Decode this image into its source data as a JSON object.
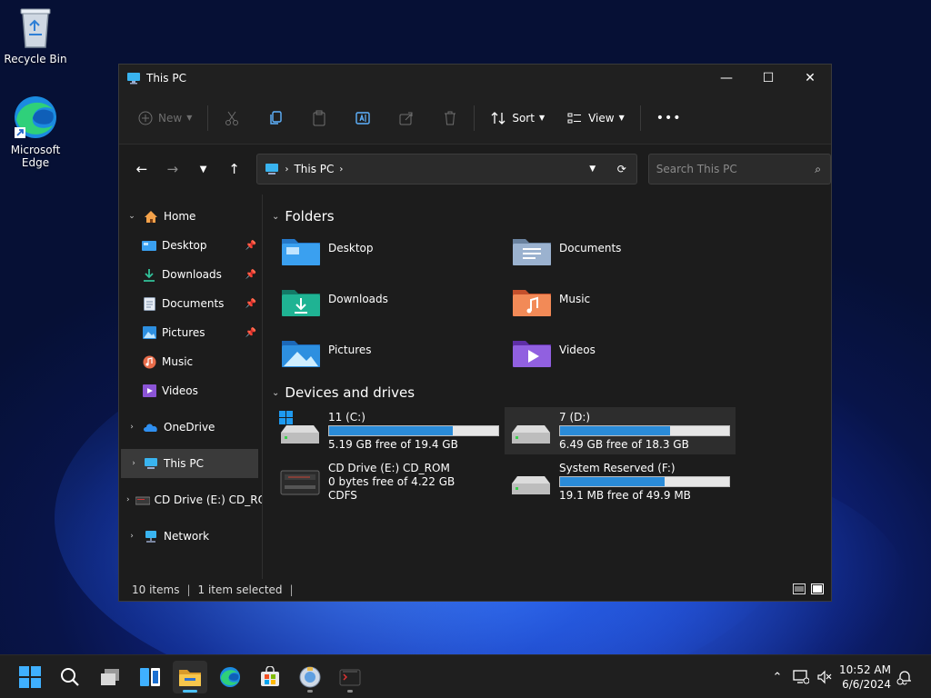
{
  "desktop": {
    "icons": [
      {
        "label": "Recycle Bin"
      },
      {
        "label": "Microsoft Edge"
      }
    ]
  },
  "window": {
    "title": "This PC",
    "controls": {
      "minimize": "—",
      "maximize": "☐",
      "close": "✕"
    }
  },
  "toolbar": {
    "new_label": "New",
    "sort_label": "Sort",
    "view_label": "View",
    "more_label": "•••"
  },
  "navigation": {
    "address": {
      "crumb": "This PC"
    },
    "search_placeholder": "Search This PC"
  },
  "sidebar": {
    "home": "Home",
    "pinned": [
      "Desktop",
      "Downloads",
      "Documents",
      "Pictures",
      "Music",
      "Videos"
    ],
    "onedrive": "OneDrive",
    "thispc": "This PC",
    "cddrive": "CD Drive (E:) CD_ROM",
    "network": "Network"
  },
  "main": {
    "folders_header": "Folders",
    "folders": [
      {
        "name": "Desktop",
        "color": "#3aa0f0"
      },
      {
        "name": "Documents",
        "color": "#8ea7c8"
      },
      {
        "name": "Downloads",
        "color": "#1fa38a"
      },
      {
        "name": "Music",
        "color": "#f0764a"
      },
      {
        "name": "Pictures",
        "color": "#2d8fe0"
      },
      {
        "name": "Videos",
        "color": "#8b54d6"
      }
    ],
    "drives_header": "Devices and drives",
    "drives": [
      {
        "name": "11 (C:)",
        "free": "5.19 GB free of 19.4 GB",
        "used_fraction": 0.73
      },
      {
        "name": "7 (D:)",
        "free": "6.49 GB free of 18.3 GB",
        "used_fraction": 0.65
      },
      {
        "name": "CD Drive (E:) CD_ROM",
        "free": "0 bytes free of 4.22 GB",
        "fs": "CDFS"
      },
      {
        "name": "System Reserved (F:)",
        "free": "19.1 MB free of 49.9 MB",
        "used_fraction": 0.62
      }
    ]
  },
  "status": {
    "count": "10 items",
    "selected": "1 item selected"
  },
  "taskbar": {
    "time": "10:52 AM",
    "date": "6/6/2024"
  },
  "colors": {
    "accent": "#4cc2ff",
    "bar_fill": "#2a8bd8"
  }
}
